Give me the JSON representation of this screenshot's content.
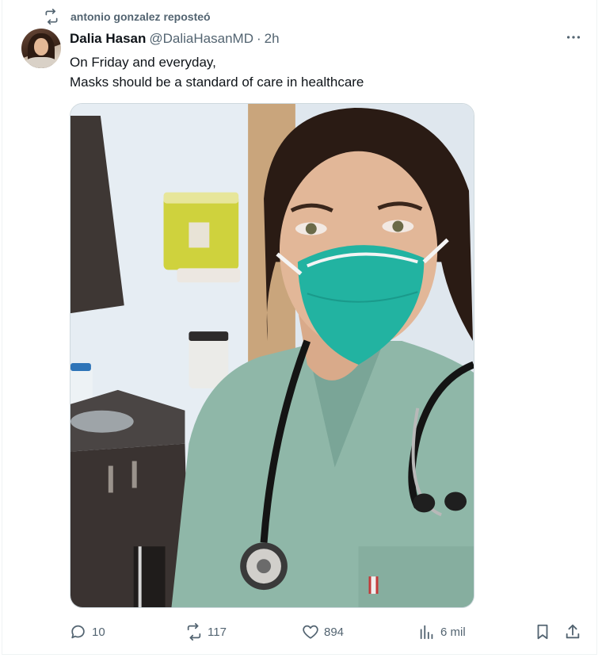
{
  "repost": {
    "icon": "repost-icon",
    "text": "antonio gonzalez reposteó"
  },
  "tweet": {
    "author": {
      "display_name": "Dalia Hasan",
      "handle": "@DaliaHasanMD",
      "separator": "·",
      "time": "2h",
      "avatar": "profile-photo"
    },
    "text_lines": [
      "On Friday and everyday,",
      "Masks should be a standard of care in healthcare"
    ],
    "media": {
      "description_icon": "photo-nurse-in-n95-mask"
    },
    "actions": {
      "replies": "10",
      "reposts": "117",
      "likes": "894",
      "views": "6 mil"
    }
  },
  "colors": {
    "text_primary": "#0f1419",
    "text_secondary": "#536471",
    "border": "#eff3f4"
  }
}
